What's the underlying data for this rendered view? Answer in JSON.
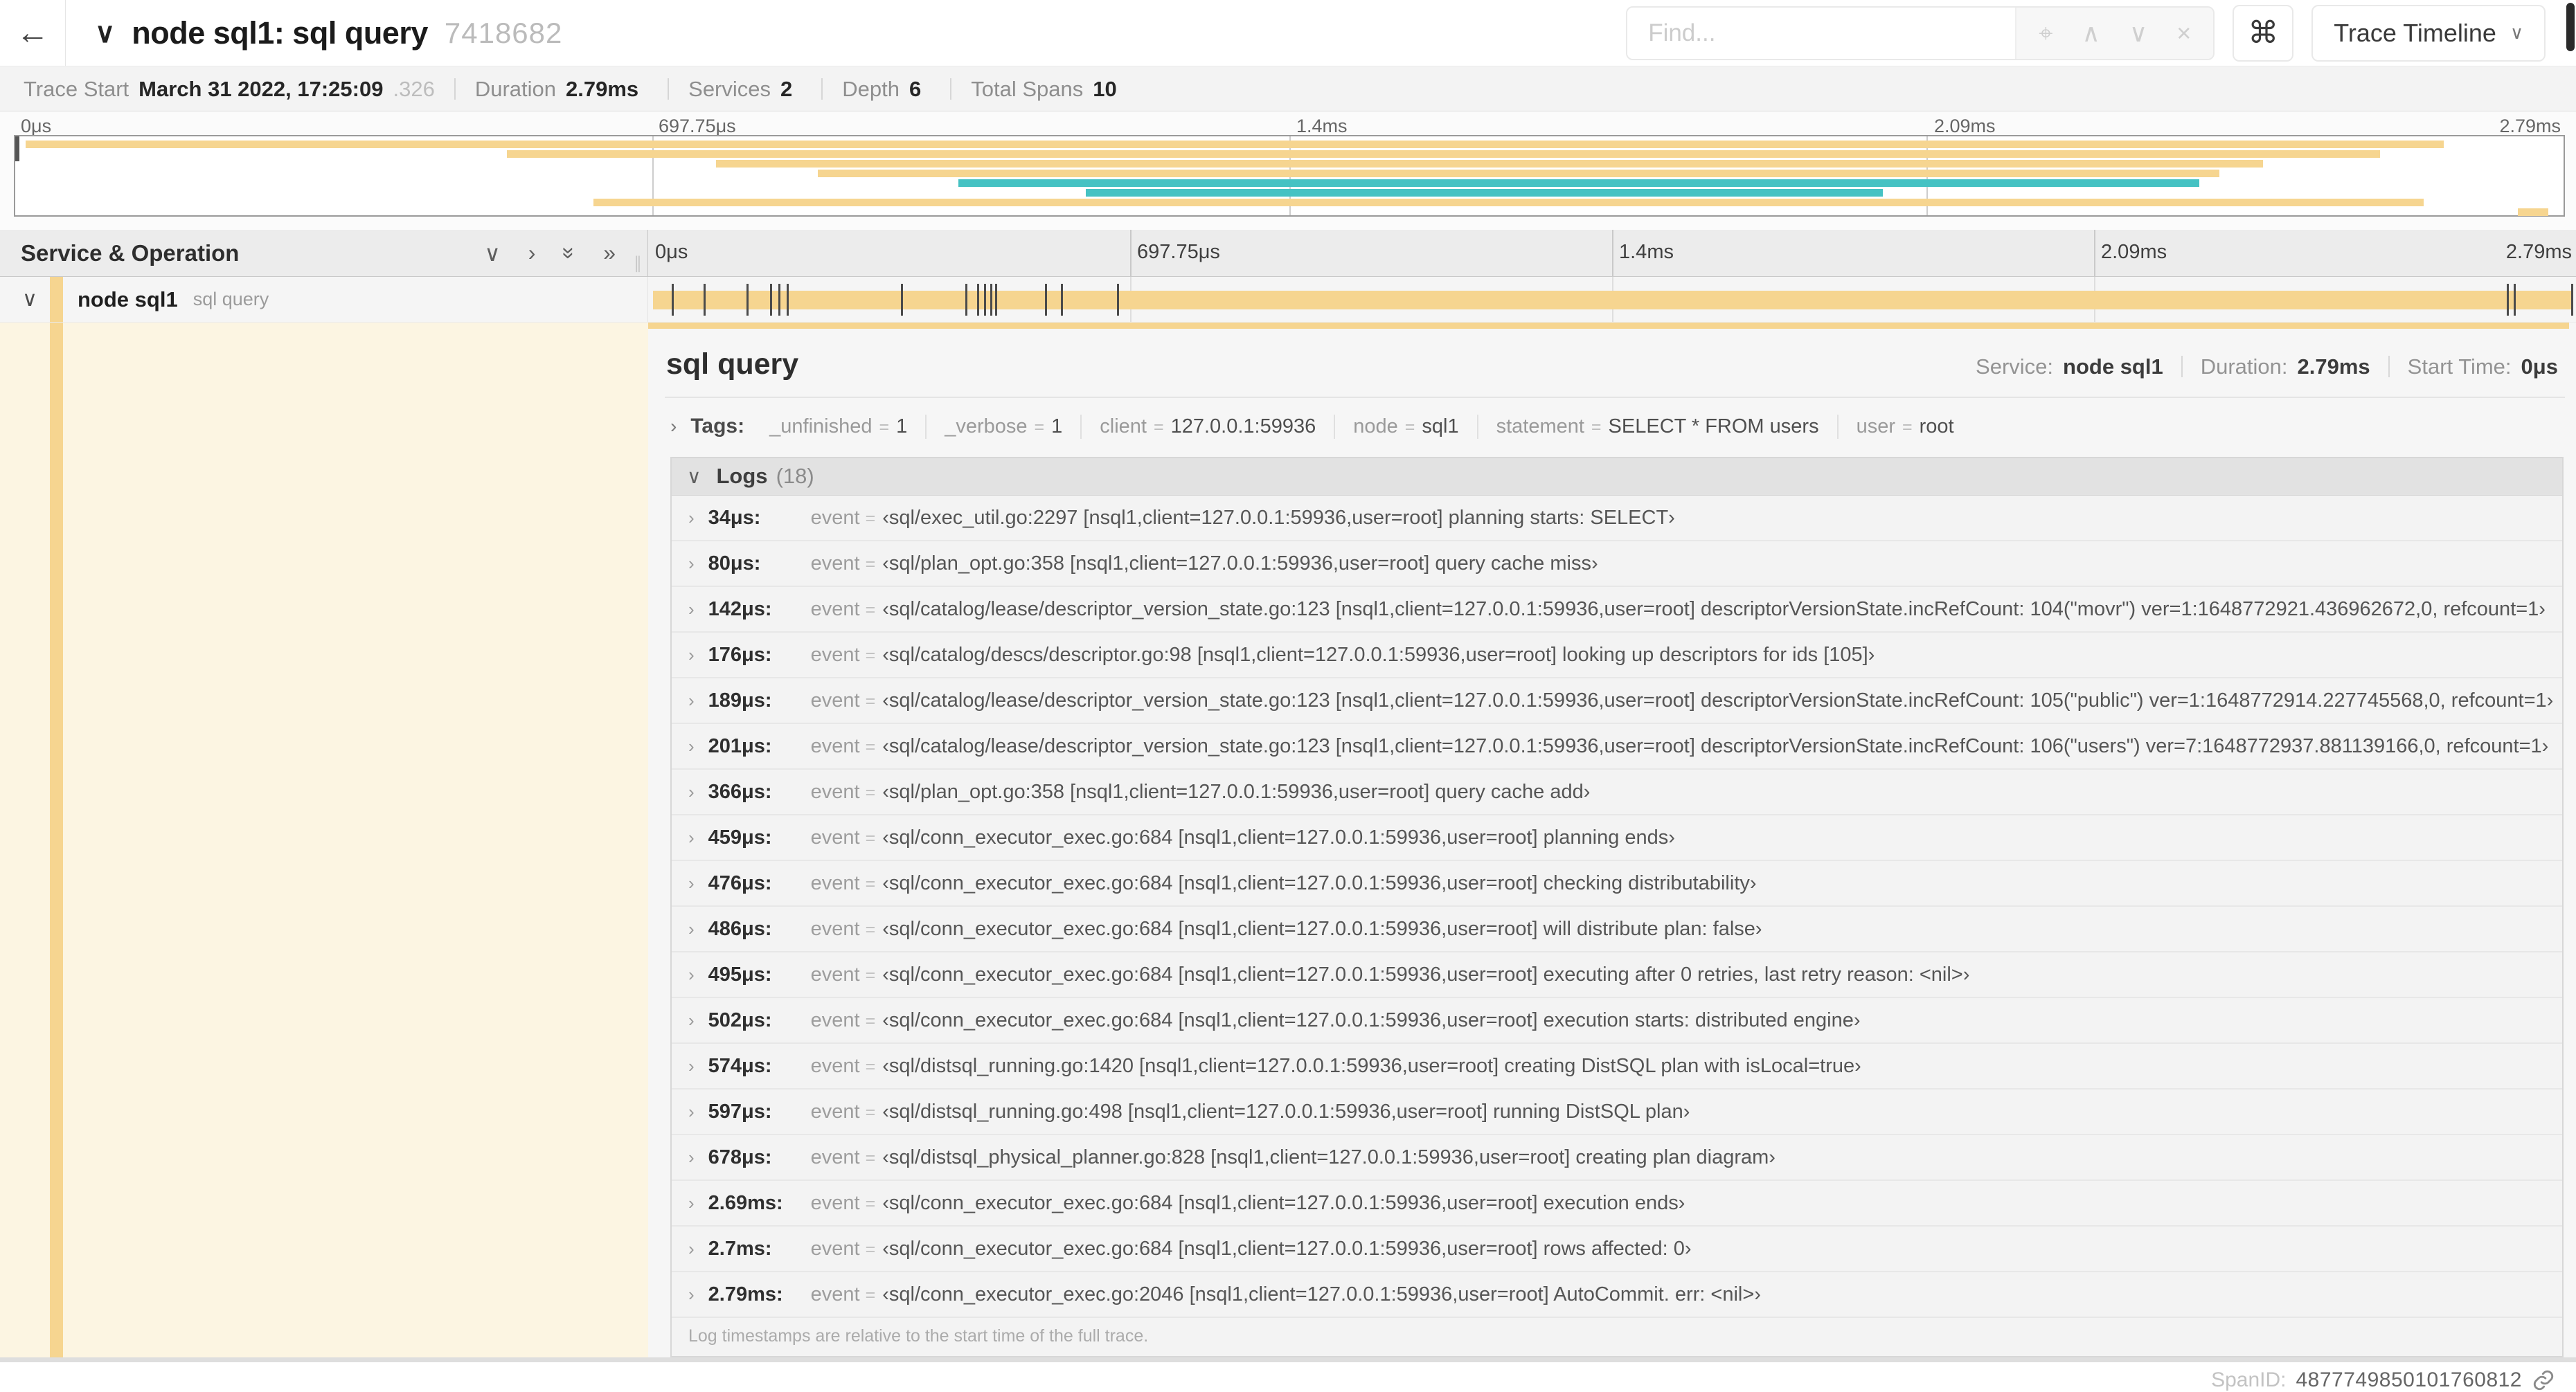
{
  "header": {
    "back_icon": "←",
    "title_chevron": "∨",
    "title": "node sql1: sql query",
    "trace_id": "7418682",
    "find_placeholder": "Find...",
    "view_selector": "Trace Timeline",
    "view_chevron": "∨"
  },
  "icons": {
    "target": "⌖",
    "prev": "∧",
    "next": "∨",
    "clear": "×",
    "command": "⌘",
    "chevron_down": "∨",
    "chevron_right": "›",
    "double_chevron": "»",
    "resizer": "∥"
  },
  "meta": {
    "items": [
      {
        "label": "Trace Start",
        "value": "March 31 2022, 17:25:09",
        "suffix": ".326"
      },
      {
        "label": "Duration",
        "value": "2.79ms"
      },
      {
        "label": "Services",
        "value": "2"
      },
      {
        "label": "Depth",
        "value": "6"
      },
      {
        "label": "Total Spans",
        "value": "10"
      }
    ]
  },
  "colors": {
    "tan": "#f6d590",
    "teal": "#45c2c3"
  },
  "timeline": {
    "column_header": "Service & Operation",
    "ticks": [
      {
        "label": "0μs",
        "pct": 0
      },
      {
        "label": "697.75μs",
        "pct": 25
      },
      {
        "label": "1.4ms",
        "pct": 50
      },
      {
        "label": "2.09ms",
        "pct": 75
      },
      {
        "label": "2.79ms",
        "pct": 100
      }
    ]
  },
  "minimap": {
    "spans": [
      {
        "left": 0.4,
        "width": 94.9,
        "color": "tan"
      },
      {
        "left": 19.3,
        "width": 73.5,
        "color": "tan"
      },
      {
        "left": 27.5,
        "width": 60.7,
        "color": "tan"
      },
      {
        "left": 31.5,
        "width": 55.0,
        "color": "tan"
      },
      {
        "left": 37.0,
        "width": 48.7,
        "color": "teal"
      },
      {
        "left": 42.0,
        "width": 31.3,
        "color": "teal"
      },
      {
        "left": 22.7,
        "width": 71.8,
        "color": "tan"
      },
      {
        "left": 98.2,
        "width": 1.2,
        "color": "tan"
      }
    ]
  },
  "span_row": {
    "service": "node sql1",
    "operation": "sql query",
    "log_marker_pcts": [
      1.22,
      2.87,
      5.09,
      6.31,
      6.77,
      7.2,
      13.12,
      16.45,
      17.06,
      17.42,
      17.74,
      17.99,
      20.57,
      21.4,
      24.3,
      96.42,
      96.77,
      99.75
    ]
  },
  "detail": {
    "title": "sql query",
    "stats": [
      {
        "label": "Service:",
        "value": "node sql1"
      },
      {
        "label": "Duration:",
        "value": "2.79ms"
      },
      {
        "label": "Start Time:",
        "value": "0μs"
      }
    ],
    "tags_title": "Tags:",
    "eq": "=",
    "tags": [
      {
        "key": "_unfinished",
        "value": "1"
      },
      {
        "key": "_verbose",
        "value": "1"
      },
      {
        "key": "client",
        "value": "127.0.0.1:59936"
      },
      {
        "key": "node",
        "value": "sql1"
      },
      {
        "key": "statement",
        "value": "SELECT * FROM users"
      },
      {
        "key": "user",
        "value": "root"
      }
    ],
    "logs_title": "Logs",
    "logs_count": "(18)",
    "log_key": "event",
    "logs": [
      {
        "t": "34μs:",
        "v": "‹sql/exec_util.go:2297 [nsql1,client=127.0.0.1:59936,user=root] planning starts: SELECT›"
      },
      {
        "t": "80μs:",
        "v": "‹sql/plan_opt.go:358 [nsql1,client=127.0.0.1:59936,user=root] query cache miss›"
      },
      {
        "t": "142μs:",
        "v": "‹sql/catalog/lease/descriptor_version_state.go:123 [nsql1,client=127.0.0.1:59936,user=root] descriptorVersionState.incRefCount: 104(\"movr\") ver=1:1648772921.436962672,0, refcount=1›"
      },
      {
        "t": "176μs:",
        "v": "‹sql/catalog/descs/descriptor.go:98 [nsql1,client=127.0.0.1:59936,user=root] looking up descriptors for ids [105]›"
      },
      {
        "t": "189μs:",
        "v": "‹sql/catalog/lease/descriptor_version_state.go:123 [nsql1,client=127.0.0.1:59936,user=root] descriptorVersionState.incRefCount: 105(\"public\") ver=1:1648772914.227745568,0, refcount=1›"
      },
      {
        "t": "201μs:",
        "v": "‹sql/catalog/lease/descriptor_version_state.go:123 [nsql1,client=127.0.0.1:59936,user=root] descriptorVersionState.incRefCount: 106(\"users\") ver=7:1648772937.881139166,0, refcount=1›"
      },
      {
        "t": "366μs:",
        "v": "‹sql/plan_opt.go:358 [nsql1,client=127.0.0.1:59936,user=root] query cache add›"
      },
      {
        "t": "459μs:",
        "v": "‹sql/conn_executor_exec.go:684 [nsql1,client=127.0.0.1:59936,user=root] planning ends›"
      },
      {
        "t": "476μs:",
        "v": "‹sql/conn_executor_exec.go:684 [nsql1,client=127.0.0.1:59936,user=root] checking distributability›"
      },
      {
        "t": "486μs:",
        "v": "‹sql/conn_executor_exec.go:684 [nsql1,client=127.0.0.1:59936,user=root] will distribute plan: false›"
      },
      {
        "t": "495μs:",
        "v": "‹sql/conn_executor_exec.go:684 [nsql1,client=127.0.0.1:59936,user=root] executing after 0 retries, last retry reason: <nil>›"
      },
      {
        "t": "502μs:",
        "v": "‹sql/conn_executor_exec.go:684 [nsql1,client=127.0.0.1:59936,user=root] execution starts: distributed engine›"
      },
      {
        "t": "574μs:",
        "v": "‹sql/distsql_running.go:1420 [nsql1,client=127.0.0.1:59936,user=root] creating DistSQL plan with isLocal=true›"
      },
      {
        "t": "597μs:",
        "v": "‹sql/distsql_running.go:498 [nsql1,client=127.0.0.1:59936,user=root] running DistSQL plan›"
      },
      {
        "t": "678μs:",
        "v": "‹sql/distsql_physical_planner.go:828 [nsql1,client=127.0.0.1:59936,user=root] creating plan diagram›"
      },
      {
        "t": "2.69ms:",
        "v": "‹sql/conn_executor_exec.go:684 [nsql1,client=127.0.0.1:59936,user=root] execution ends›"
      },
      {
        "t": "2.7ms:",
        "v": "‹sql/conn_executor_exec.go:684 [nsql1,client=127.0.0.1:59936,user=root] rows affected: 0›"
      },
      {
        "t": "2.79ms:",
        "v": "‹sql/conn_executor_exec.go:2046 [nsql1,client=127.0.0.1:59936,user=root] AutoCommit. err: <nil>›"
      }
    ],
    "logs_note": "Log timestamps are relative to the start time of the full trace.",
    "spanid_label": "SpanID:",
    "spanid": "4877749850101760812"
  }
}
